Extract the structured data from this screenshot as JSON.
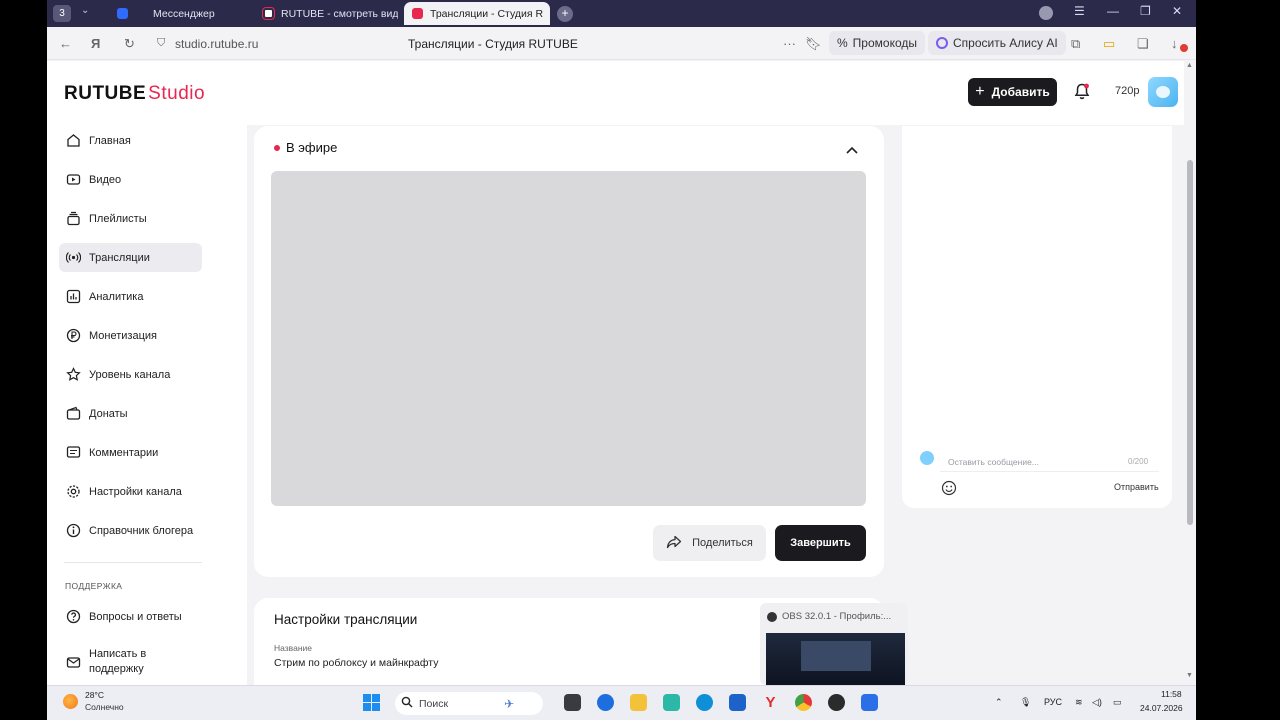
{
  "browser": {
    "tab_counter": "3",
    "tabs": [
      {
        "label": "Мессенджер",
        "color": "#2f6bff"
      },
      {
        "label": "RUTUBE - смотреть виде",
        "color": "#ffffff"
      },
      {
        "label": "Трансляции - Студия R",
        "color": "#e8264f"
      }
    ],
    "url": "studio.rutube.ru",
    "page_title": "Трансляции - Студия RUTUBE",
    "promo_label": "Промокоды",
    "alice_label": "Спросить Алису AI"
  },
  "header": {
    "logo_brand": "RUTUBE",
    "logo_product": "Studio",
    "add_label": "Добавить",
    "quality": "720p"
  },
  "sidebar": {
    "items": [
      {
        "label": "Главная",
        "icon": "home-icon"
      },
      {
        "label": "Видео",
        "icon": "video-icon"
      },
      {
        "label": "Плейлисты",
        "icon": "playlist-icon"
      },
      {
        "label": "Трансляции",
        "icon": "broadcast-icon"
      },
      {
        "label": "Аналитика",
        "icon": "analytics-icon"
      },
      {
        "label": "Монетизация",
        "icon": "ruble-icon"
      },
      {
        "label": "Уровень канала",
        "icon": "star-icon"
      },
      {
        "label": "Донаты",
        "icon": "wallet-icon"
      },
      {
        "label": "Комментарии",
        "icon": "comment-icon"
      },
      {
        "label": "Настройки канала",
        "icon": "gear-icon"
      },
      {
        "label": "Справочник блогера",
        "icon": "info-icon"
      }
    ],
    "support_title": "ПОДДЕРЖКА",
    "support_items": [
      {
        "label": "Вопросы и ответы",
        "icon": "question-icon"
      },
      {
        "label": "Написать в поддержку",
        "icon": "mail-icon"
      }
    ]
  },
  "live": {
    "title": "В эфире",
    "share_label": "Поделиться",
    "finish_label": "Завершить"
  },
  "chat": {
    "placeholder": "Оставить сообщение...",
    "counter": "0/200",
    "send_label": "Отправить"
  },
  "settings": {
    "title": "Настройки трансляции",
    "name_label": "Название",
    "name_value": "Стрим по роблоксу и майнкрафту"
  },
  "obs_popup": {
    "title": "OBS 32.0.1 - Профиль:..."
  },
  "taskbar": {
    "temperature": "28°C",
    "weather": "Солнечно",
    "search_label": "Поиск",
    "language": "РУС",
    "time": "11:58",
    "date": "24.07.2026"
  },
  "colors": {
    "accent": "#e8264f",
    "dark_button": "#1b1b1f"
  }
}
